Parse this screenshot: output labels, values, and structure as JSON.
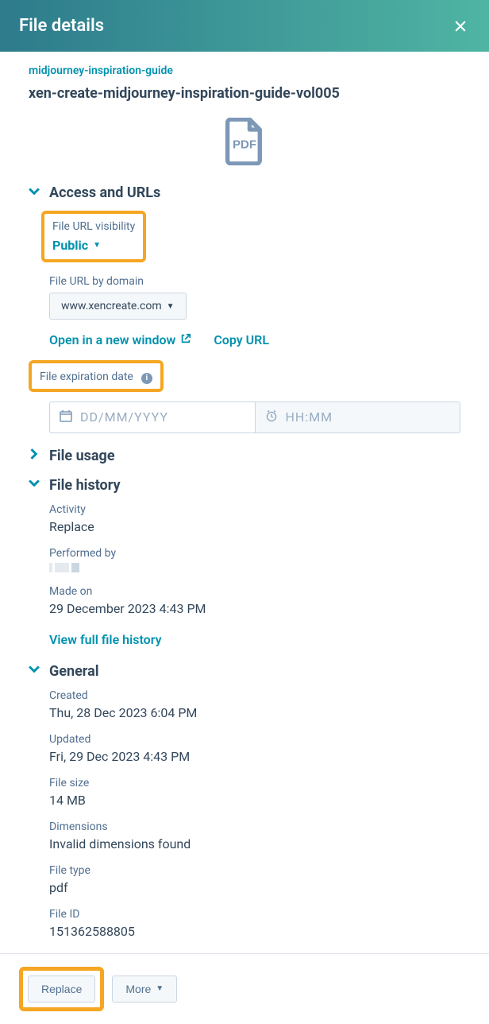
{
  "header": {
    "title": "File details"
  },
  "breadcrumb": "midjourney-inspiration-guide",
  "file_name": "xen-create-midjourney-inspiration-guide-vol005",
  "sections": {
    "access": {
      "title": "Access and URLs",
      "url_visibility_label": "File URL visibility",
      "url_visibility_value": "Public",
      "url_domain_label": "File URL by domain",
      "url_domain_value": "www.xencreate.com",
      "open_new_window": "Open in a new window",
      "copy_url": "Copy URL",
      "expiration_label": "File expiration date",
      "date_placeholder": "DD/MM/YYYY",
      "time_placeholder": "HH:MM"
    },
    "usage": {
      "title": "File usage"
    },
    "history": {
      "title": "File history",
      "activity_label": "Activity",
      "activity_value": "Replace",
      "performed_by_label": "Performed by",
      "made_on_label": "Made on",
      "made_on_value": "29 December 2023 4:43 PM",
      "view_full": "View full file history"
    },
    "general": {
      "title": "General",
      "created_label": "Created",
      "created_value": "Thu, 28 Dec 2023 6:04 PM",
      "updated_label": "Updated",
      "updated_value": "Fri, 29 Dec 2023 4:43 PM",
      "size_label": "File size",
      "size_value": "14 MB",
      "dimensions_label": "Dimensions",
      "dimensions_value": "Invalid dimensions found",
      "type_label": "File type",
      "type_value": "pdf",
      "id_label": "File ID",
      "id_value": "151362588805"
    }
  },
  "footer": {
    "replace": "Replace",
    "more": "More"
  }
}
